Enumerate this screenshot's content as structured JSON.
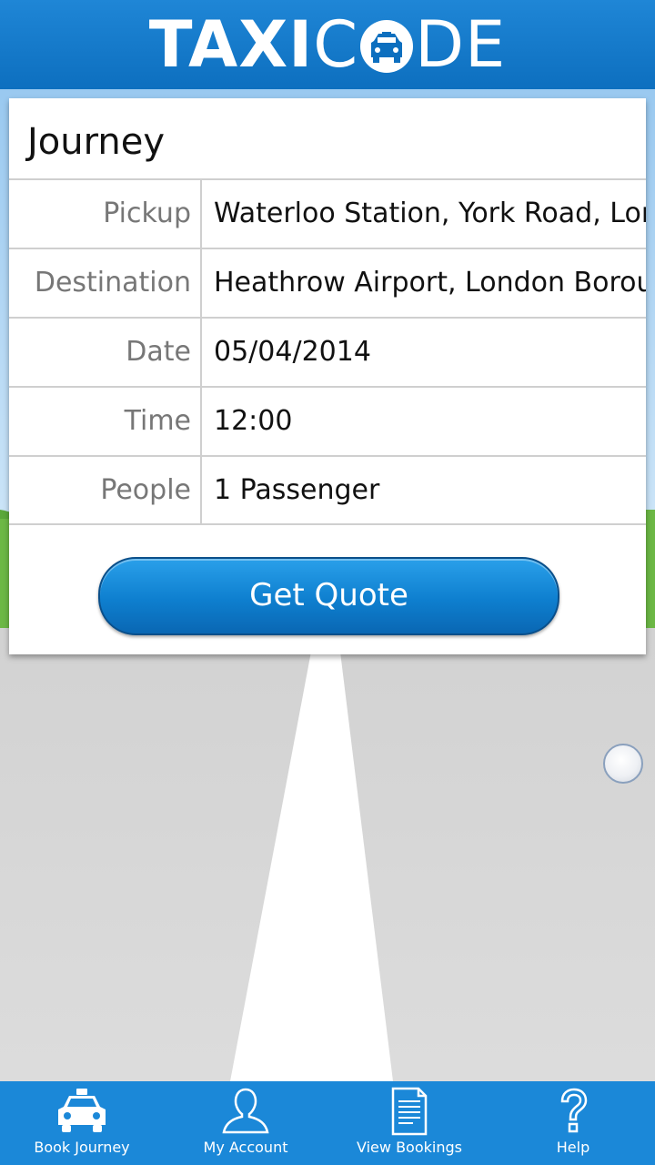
{
  "header": {
    "logo_text_bold": "TAXI",
    "logo_text_light_1": "C",
    "logo_text_light_2": "DE"
  },
  "journey": {
    "title": "Journey",
    "rows": [
      {
        "label": "Pickup",
        "value": "Waterloo Station, York Road, London"
      },
      {
        "label": "Destination",
        "value": "Heathrow Airport, London Borough of Hillingdon"
      },
      {
        "label": "Date",
        "value": "05/04/2014"
      },
      {
        "label": "Time",
        "value": "12:00"
      },
      {
        "label": "People",
        "value": "1 Passenger"
      }
    ],
    "quote_button": "Get Quote"
  },
  "nav": {
    "items": [
      {
        "label": "Book Journey",
        "icon": "taxi-icon"
      },
      {
        "label": "My Account",
        "icon": "person-icon"
      },
      {
        "label": "View Bookings",
        "icon": "document-icon"
      },
      {
        "label": "Help",
        "icon": "question-icon"
      }
    ]
  },
  "colors": {
    "brand_blue": "#1b88d8",
    "button_blue": "#0e7fcf"
  }
}
